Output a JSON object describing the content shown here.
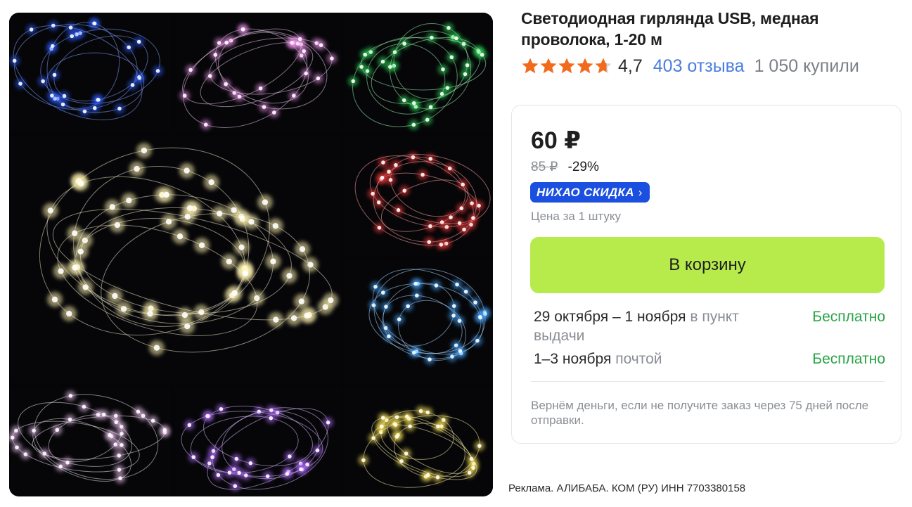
{
  "product": {
    "title": "Светодиодная гирлянда USB, медная проволока, 1-20 м",
    "rating_value": "4,7",
    "rating_stars": 4.7,
    "reviews": "403 отзыва",
    "bought": "1 050 купили",
    "gallery_image": "led-copper-wire-garland-photo-collage"
  },
  "buy_box": {
    "price": "60 ₽",
    "old_price": "85 ₽",
    "discount": "-29%",
    "promo_badge": "НИХАО СКИДКА",
    "promo_chevron": "›",
    "unit_note": "Цена за 1 штуку",
    "cart_button": "В корзину",
    "delivery": [
      {
        "dates": "29 октября – 1 ноября",
        "method": "в пункт выдачи",
        "cost": "Бесплатно"
      },
      {
        "dates": "1–3 ноября",
        "method": "почтой",
        "cost": "Бесплатно"
      }
    ],
    "guarantee": "Вернём деньги, если не получите заказ через 75 дней после отправки."
  },
  "footer": {
    "ad_label": "Реклама. АЛИБАБА. КОМ (РУ) ИНН 7703380158"
  },
  "colors": {
    "star": "#f26a1b",
    "star_empty": "#d6d6d6",
    "link": "#4a7ddf",
    "cart_button": "#b7ea4b",
    "promo_badge": "#1a4fe0",
    "free_delivery": "#2aa447"
  }
}
